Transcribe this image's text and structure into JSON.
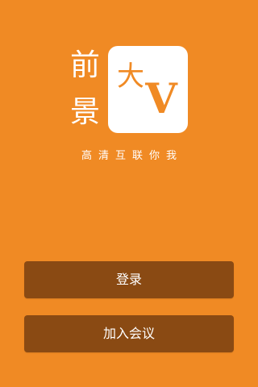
{
  "theme": {
    "background": "#f08a24",
    "button_background": "#8a4a13",
    "logo_badge_background": "#ffffff",
    "logo_badge_text": "#f08a24"
  },
  "logo": {
    "line1": "前",
    "line2": "景",
    "badge_char": "大",
    "badge_letter": "V"
  },
  "tagline": "高清互联你我",
  "buttons": {
    "login_label": "登录",
    "join_meeting_label": "加入会议"
  }
}
